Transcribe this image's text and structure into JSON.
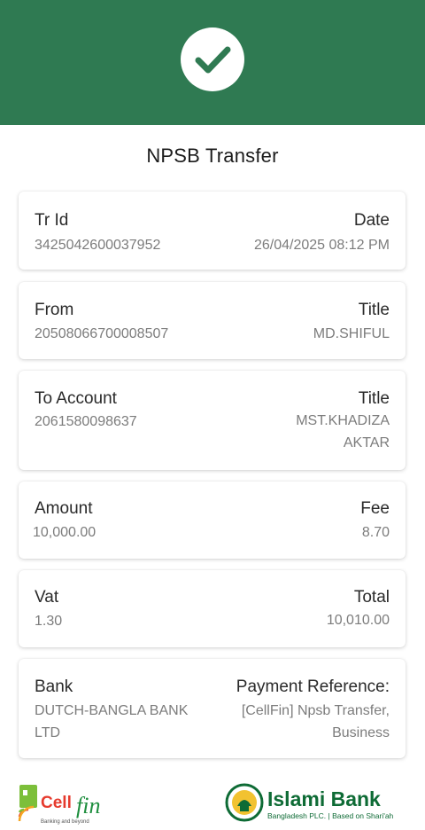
{
  "header": {
    "status_icon": "check-circle-icon",
    "bg_color": "#2f7a52"
  },
  "page_title": "NPSB Transfer",
  "cards": {
    "tr": {
      "left_label": "Tr Id",
      "left_value": "3425042600037952",
      "right_label": "Date",
      "right_value": "26/04/2025 08:12 PM"
    },
    "from": {
      "left_label": "From",
      "left_value": "20508066700008507",
      "right_label": "Title",
      "right_value": "MD.SHIFUL"
    },
    "to": {
      "left_label": "To Account",
      "left_value": "2061580098637",
      "right_label": "Title",
      "right_value_line1": "MST.KHADIZA",
      "right_value_line2": "AKTAR"
    },
    "amount": {
      "left_label": "Amount",
      "left_value": "10,000.00",
      "right_label": "Fee",
      "right_value": "8.70"
    },
    "vat": {
      "left_label": "Vat",
      "left_value": "1.30",
      "right_label": "Total",
      "right_value": "10,010.00"
    },
    "bank": {
      "left_label": "Bank",
      "left_value_line1": "DUTCH-BANGLA BANK",
      "left_value_line2": "LTD",
      "right_label": "Payment Reference:",
      "right_value_line1": "[CellFin] Npsb Transfer,",
      "right_value_line2": "Business"
    }
  },
  "footer": {
    "cellfin_logo": {
      "name": "CellFin",
      "prefix": "Cell",
      "suffix": "fin",
      "tagline": "Banking and beyond"
    },
    "islami_logo": {
      "name": "Islami Bank",
      "subtitle": "Bangladesh PLC. | Based on Shari'ah"
    }
  }
}
